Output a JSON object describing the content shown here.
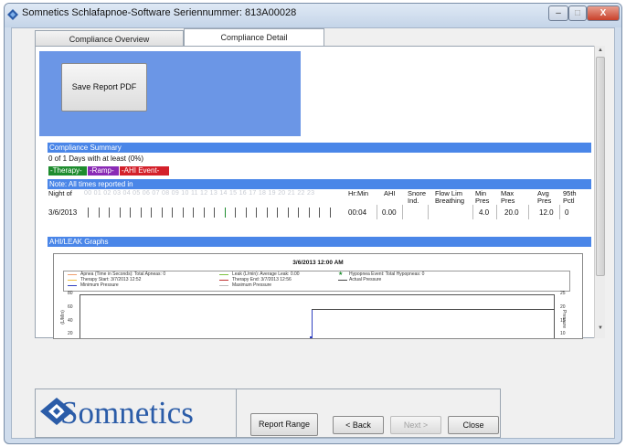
{
  "window": {
    "title": "Somnetics Schlafapnoe-Software   Seriennummer: 813A00028",
    "minimize": "–",
    "maximize": "□",
    "close": "X"
  },
  "tabs": [
    {
      "label": "Compliance Overview"
    },
    {
      "label": "Compliance Detail"
    }
  ],
  "report": {
    "save_pdf_label": "Save Report PDF"
  },
  "compliance": {
    "header": "Compliance Summary",
    "days_text": "0 of 1 Days with at least (0%)",
    "legend": {
      "therapy": "-Therapy-",
      "ramp": "-Ramp-",
      "ahi_event": "-AHI Event-"
    },
    "colors": {
      "therapy": "#1e8c2e",
      "ramp": "#8a2ab5",
      "ahi_event": "#d4202a",
      "section": "#4a86e8"
    },
    "note": "Note:  All times reported in",
    "columns": {
      "night_of": "Night of",
      "hours": "00 01 02 03 04 05 06 07 08 09 10 11 12 13 14 15 16 17 18 19 20 21 22 23",
      "hr_min": "Hr:Min",
      "ahi": "AHI",
      "snore": "Snore Ind.",
      "flow": "Flow Lim Breathing",
      "min_pres": "Min Pres",
      "max_pres": "Max Pres",
      "avg_pres": "Avg Pres",
      "p95": "95th Pctl"
    },
    "row": {
      "night": "3/6/2013",
      "hr_min": "00:04",
      "ahi": "0.00",
      "snore": "",
      "flow": "",
      "min_pres": "4.0",
      "max_pres": "20.0",
      "avg_pres": "12.0",
      "p95": "0"
    }
  },
  "graph": {
    "header": "AHI/LEAK Graphs",
    "title": "3/6/2013 12:00 AM",
    "legend": [
      "Apnea (Time in Seconds): Total Apneas: 0",
      "Leak (L/min): Average Leak: 0.00",
      "Hypopnea Event: Total Hypopneas: 0",
      "Therapy Start: 3/7/2013 12:52",
      "Therapy End: 3/7/2013 12:56",
      "Actual Pressure",
      "Minimum Pressure",
      "Maximum Pressure"
    ],
    "left_axis_label": "(L/Min)",
    "right_axis_label": "Pressure",
    "left_ticks": [
      "80",
      "60",
      "40",
      "20"
    ],
    "right_ticks": [
      "25",
      "20",
      "15",
      "10"
    ]
  },
  "footer": {
    "logo": "Somnetics",
    "report_range": "Report Range",
    "back": "< Back",
    "next": "Next >",
    "close": "Close"
  }
}
